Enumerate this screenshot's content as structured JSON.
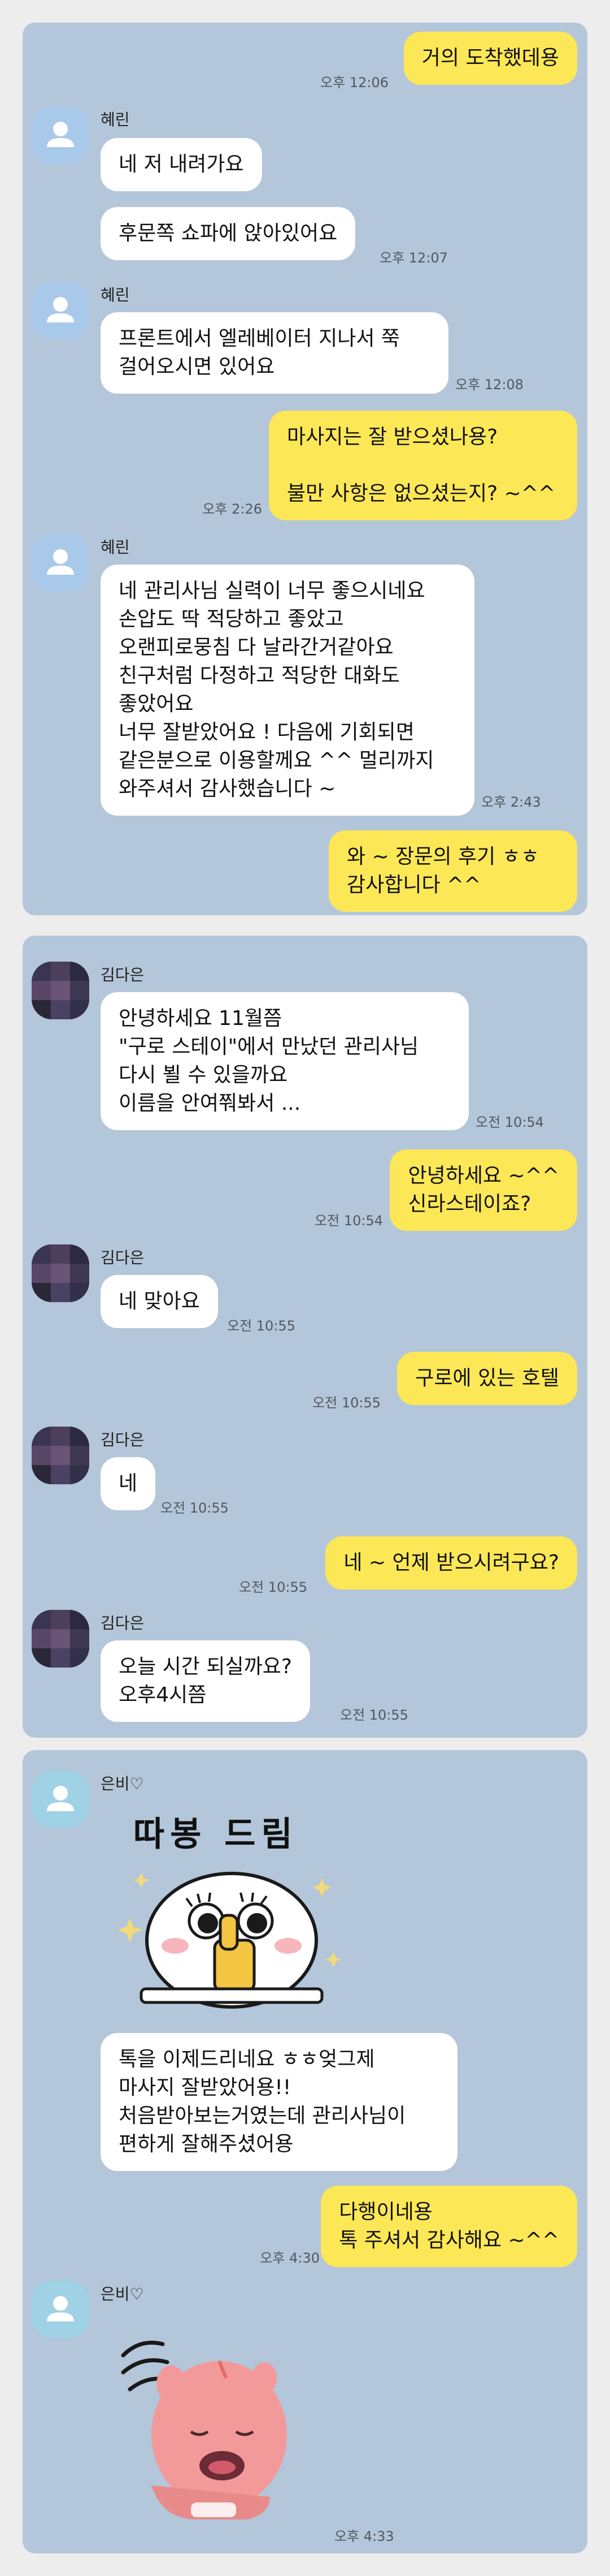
{
  "card1": {
    "sender": "혜린",
    "messages": [
      {
        "text": "거의 도착했데용",
        "time": "오후 12:06"
      },
      {
        "text": "네 저 내려가요"
      },
      {
        "text": "후문쪽 쇼파에 앉아있어요",
        "time": "오후 12:07"
      },
      {
        "text": "프론트에서 엘레베이터 지나서 쭉\n걸어오시면 있어요",
        "time": "오후 12:08"
      },
      {
        "text": "마사지는 잘 받으셨나용?\n\n불만 사항은 없으셨는지? ~^^",
        "time": "오후 2:26"
      },
      {
        "text": "네 관리사님 실력이 너무 좋으시네요\n손압도 딱 적당하고 좋았고\n오랜피로뭉침 다 날라간거같아요\n친구처럼 다정하고 적당한 대화도\n좋았어요\n너무 잘받았어요 ! 다음에 기회되면\n같은분으로 이용할께요 ^^ 멀리까지\n와주셔서 감사했습니다 ~",
        "time": "오후 2:43"
      },
      {
        "text": "와 ~ 장문의 후기 ㅎㅎ\n감사합니다 ^^"
      }
    ]
  },
  "card2": {
    "sender": "김다은",
    "messages": [
      {
        "text": "안녕하세요 11월쯤\n\"구로 스테이\"에서 만났던 관리사님\n다시 뵐 수 있을까요\n이름을 안여쭤봐서 ...",
        "time": "오전 10:54"
      },
      {
        "text": "안녕하세요 ~^^\n신라스테이죠?",
        "time": "오전 10:54"
      },
      {
        "text": "네 맞아요",
        "time": "오전 10:55"
      },
      {
        "text": "구로에 있는 호텔",
        "time": "오전 10:55"
      },
      {
        "text": "네",
        "time": "오전 10:55"
      },
      {
        "text": "네 ~ 언제 받으시려구요?",
        "time": "오전 10:55"
      },
      {
        "text": "오늘  시간 되실까요?\n오후4시쯤",
        "time": "오전 10:55"
      }
    ]
  },
  "card3": {
    "sender": "은비♡",
    "sticker_caption": "따봉 드림",
    "messages": [
      {
        "text": "톡을 이제드리네요 ㅎㅎ엊그제\n마사지 잘받았어용!!\n처음받아보는거였는데 관리사님이\n편하게 잘해주셨어용"
      },
      {
        "text": "다행이네용\n톡 주셔서 감사해요 ~^^",
        "time": "오후 4:30"
      },
      {
        "time": "오후 4:33"
      }
    ]
  },
  "colors": {
    "card_bg": "#b4c6d9",
    "outgoing_bubble": "#fce756",
    "incoming_bubble": "#ffffff",
    "page_bg": "#ededee"
  },
  "icons": [
    "default-profile-icon",
    "pixelated-profile-photo",
    "thumbs-up-sticker",
    "pink-creature-sticker"
  ]
}
